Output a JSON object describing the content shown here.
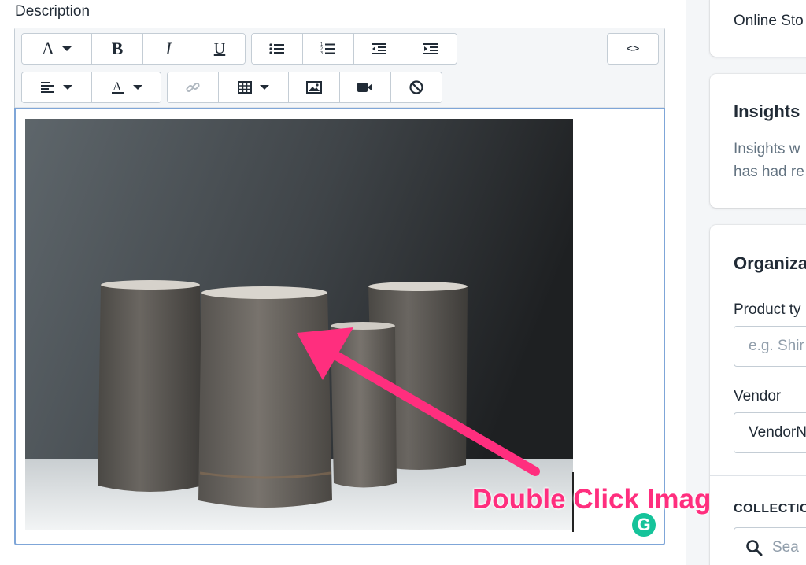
{
  "description_label": "Description",
  "toolbar": {
    "row1": [
      {
        "name": "font-format-dropdown",
        "glyph": "A",
        "style": "serifA",
        "caret": true
      },
      {
        "name": "bold-button",
        "glyph": "B",
        "style": "bold"
      },
      {
        "name": "italic-button",
        "glyph": "I",
        "style": "italic"
      },
      {
        "name": "underline-button",
        "glyph": "U",
        "style": "under"
      }
    ],
    "code_label": "<>",
    "row2_align_caret": true
  },
  "annotation": {
    "text": "Double Click Image",
    "color": "#ff2e7e"
  },
  "grammarly": {
    "letter": "G",
    "color": "#15c39a"
  },
  "sidebar": {
    "online_store": "Online Sto",
    "insights": {
      "title": "Insights",
      "line1": "Insights w",
      "line2": "has had re"
    },
    "organization": {
      "title": "Organiza",
      "product_type_label": "Product ty",
      "product_type_placeholder": "e.g. Shir",
      "vendor_label": "Vendor",
      "vendor_value": "VendorN",
      "collections_label": "COLLECTIO",
      "search_placeholder": "Sea"
    }
  }
}
